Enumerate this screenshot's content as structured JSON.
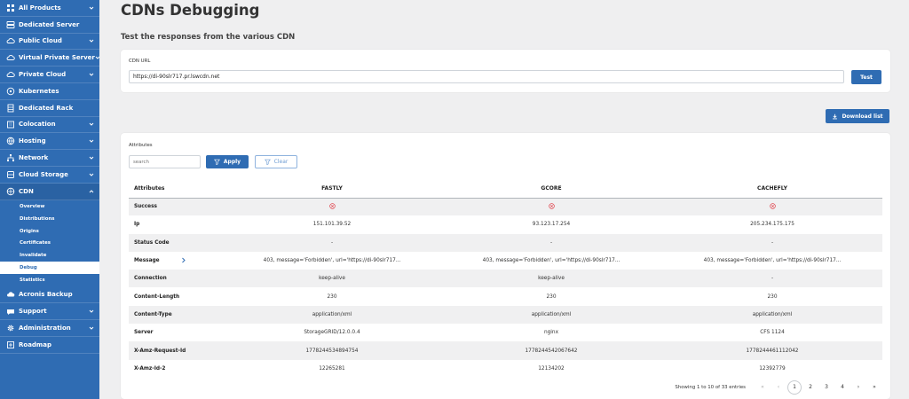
{
  "sidebar": {
    "items": [
      {
        "label": "All Products",
        "icon": "grid-icon",
        "chevron": true
      },
      {
        "label": "Dedicated Server",
        "icon": "server-icon",
        "chevron": false
      },
      {
        "label": "Public Cloud",
        "icon": "cloud-icon",
        "chevron": true
      },
      {
        "label": "Virtual Private Server",
        "icon": "cloud-icon",
        "chevron": true
      },
      {
        "label": "Private Cloud",
        "icon": "cloud-icon",
        "chevron": true
      },
      {
        "label": "Kubernetes",
        "icon": "kubernetes-icon",
        "chevron": false
      },
      {
        "label": "Dedicated Rack",
        "icon": "rack-icon",
        "chevron": false
      },
      {
        "label": "Colocation",
        "icon": "building-icon",
        "chevron": true
      },
      {
        "label": "Hosting",
        "icon": "globe-icon",
        "chevron": true
      },
      {
        "label": "Network",
        "icon": "network-icon",
        "chevron": true
      },
      {
        "label": "Cloud Storage",
        "icon": "storage-icon",
        "chevron": true
      },
      {
        "label": "CDN",
        "icon": "cdn-icon",
        "chevron": true
      }
    ],
    "cdn_sub": [
      "Overview",
      "Distributions",
      "Origins",
      "Certificates",
      "Invalidate",
      "Debug",
      "Statistics"
    ],
    "cdn_active": "Debug",
    "bottom_items": [
      {
        "label": "Acronis Backup",
        "icon": "backup-icon",
        "chevron": false
      },
      {
        "label": "Support",
        "icon": "support-icon",
        "chevron": true
      },
      {
        "label": "Administration",
        "icon": "gear-icon",
        "chevron": true
      },
      {
        "label": "Roadmap",
        "icon": "roadmap-icon",
        "chevron": false
      }
    ]
  },
  "page": {
    "title": "CDNs Debugging",
    "subtitle": "Test the responses from the various CDN"
  },
  "url_form": {
    "label": "CDN URL",
    "value": "https://di-90slr717.pr.lswcdn.net",
    "test_button": "Test"
  },
  "download_button": "Download list",
  "filter": {
    "label": "Attributes",
    "search_placeholder": "search",
    "apply_button": "Apply",
    "clear_button": "Clear"
  },
  "table": {
    "headers": [
      "Attributes",
      "FASTLY",
      "GCORE",
      "CACHEFLY"
    ],
    "rows": [
      {
        "attr": "Success",
        "values": [
          "x",
          "x",
          "x"
        ],
        "kind": "icon"
      },
      {
        "attr": "Ip",
        "values": [
          "151.101.39.52",
          "93.123.17.254",
          "205.234.175.175"
        ]
      },
      {
        "attr": "Status Code",
        "values": [
          "-",
          "-",
          "-"
        ]
      },
      {
        "attr": "Message",
        "values": [
          "403, message='Forbidden', url='https://di-90slr717...",
          "403, message='Forbidden', url='https://di-90slr717...",
          "403, message='Forbidden', url='https://di-90slr717..."
        ],
        "expandable": true
      },
      {
        "attr": "Connection",
        "values": [
          "keep-alive",
          "keep-alive",
          "-"
        ]
      },
      {
        "attr": "Content-Length",
        "values": [
          "230",
          "230",
          "230"
        ]
      },
      {
        "attr": "Content-Type",
        "values": [
          "application/xml",
          "application/xml",
          "application/xml"
        ]
      },
      {
        "attr": "Server",
        "values": [
          "StorageGRID/12.0.0.4",
          "nginx",
          "CFS 1124"
        ]
      },
      {
        "attr": "X-Amz-Request-Id",
        "values": [
          "1778244534894754",
          "1778244542067642",
          "1778244461112042"
        ]
      },
      {
        "attr": "X-Amz-Id-2",
        "values": [
          "12265281",
          "12134202",
          "12392779"
        ]
      }
    ]
  },
  "pagination": {
    "info": "Showing 1 to 10 of 33 entries",
    "first": "«",
    "prev": "‹",
    "pages": [
      "1",
      "2",
      "3",
      "4"
    ],
    "current": "1",
    "next": "›",
    "last": "»"
  },
  "colors": {
    "brand": "#2f6cb3",
    "error": "#e0454f"
  }
}
